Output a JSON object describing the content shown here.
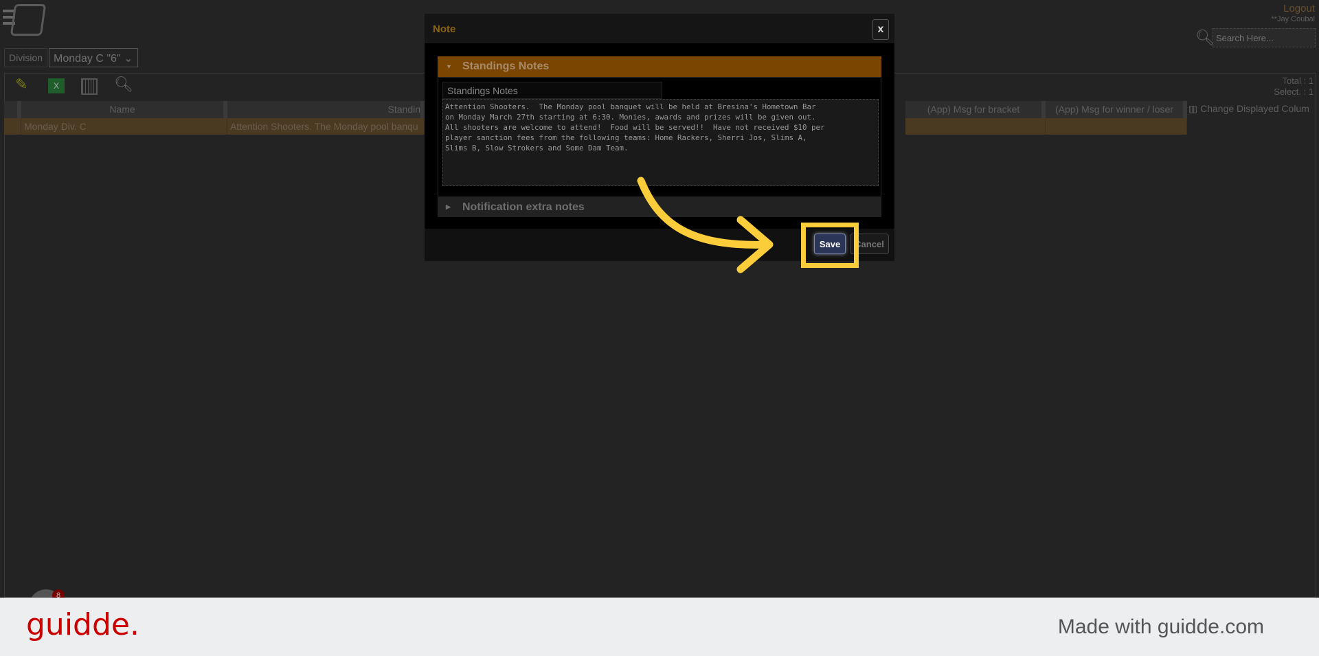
{
  "header": {
    "division_label": "Division",
    "division_value": "Monday C \"6\"",
    "logout": "Logout",
    "username": "**Jay Coubal",
    "search_placeholder": "Search Here..."
  },
  "toolbar": {
    "icons": [
      "pencil-icon",
      "excel-icon",
      "columns-icon",
      "search-icon"
    ],
    "total": "Total : 1",
    "selected": "Select. : 1",
    "change_columns": "Change Displayed Colum"
  },
  "table": {
    "columns": [
      "Name",
      "Standin",
      "(App) Msg for bracket",
      "(App) Msg for winner / loser"
    ],
    "rows": [
      {
        "name": "Monday Div. C",
        "standings": "Attention Shooters. The Monday pool banqu",
        "bracket": "",
        "winner": ""
      }
    ]
  },
  "modal": {
    "title": "Note",
    "close": "x",
    "section1": "Standings Notes",
    "field_label": "Standings Notes",
    "note_text": "Attention Shooters.  The Monday pool banquet will be held at Bresina's Hometown Bar\non Monday March 27th starting at 6:30. Monies, awards and prizes will be given out.\nAll shooters are welcome to attend!  Food will be served!!  Have not received $10 per\nplayer sanction fees from the following teams: Home Rackers, Sherri Jos, Slims A,\nSlims B, Slow Strokers and Some Dam Team.",
    "section2": "Notification extra notes",
    "save": "Save",
    "cancel": "Cancel"
  },
  "chat": {
    "badge_count": "8"
  },
  "footer": {
    "brand": "guidde.",
    "tagline": "Made with guidde.com"
  },
  "colors": {
    "accent": "#7a4500",
    "highlight": "#fccd3a",
    "brand": "#cc0000"
  }
}
